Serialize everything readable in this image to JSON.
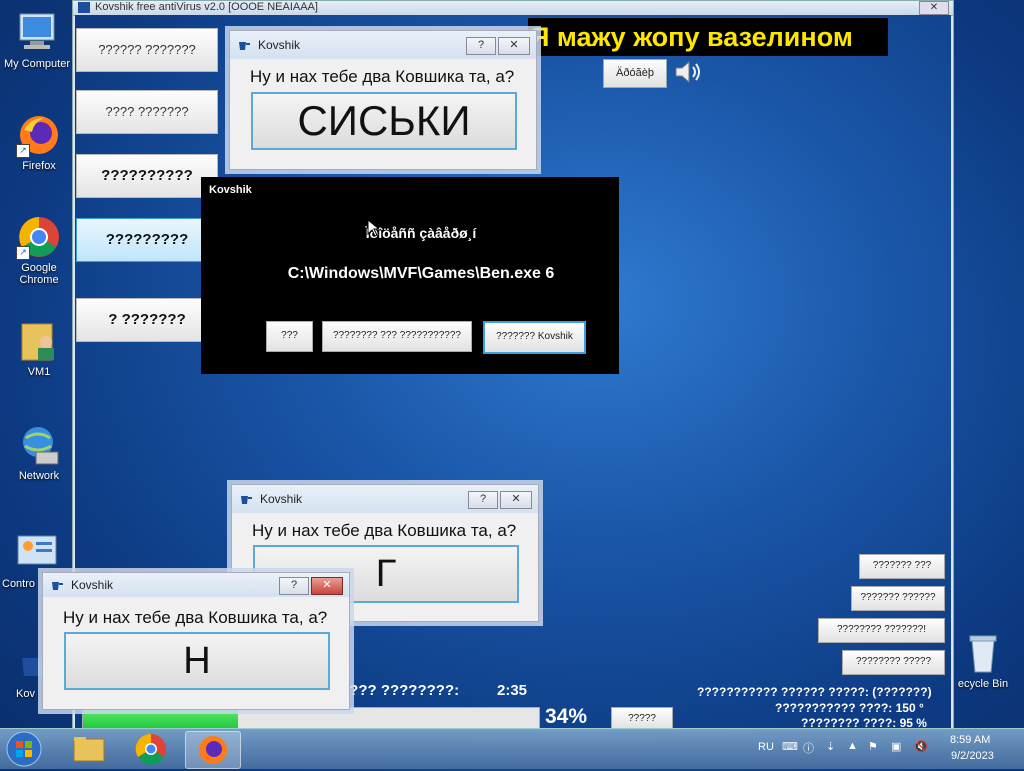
{
  "desktop": {
    "icons": [
      {
        "label": "My Computer"
      },
      {
        "label": "Firefox"
      },
      {
        "label": "Google Chrome"
      },
      {
        "label": "VM1"
      },
      {
        "label": "Network"
      },
      {
        "label": "Contro"
      },
      {
        "label": "Kov"
      },
      {
        "label": "ecycle Bin"
      }
    ]
  },
  "main_window": {
    "title": "Kovshik free antiVirus v2.0 [OOOE NEAIAAA]",
    "close_label": "✕",
    "side_buttons": [
      "?????? ???????",
      "???? ???????",
      "??????????",
      "?????????",
      "? ???????"
    ],
    "banner": "Я мажу жопу вазелином",
    "top_button": "Äðóãèþ",
    "right_buttons": [
      "??????? ???",
      "??????? ??????",
      "???????? ???????!",
      "???????? ?????"
    ],
    "elapsed_label": "???? ????????:",
    "elapsed_value": "2:35",
    "progress_percent_label": "34%",
    "progress_percent": 34,
    "bottom_button": "?????",
    "stats": [
      "??????????? ?????? ?????: (???????)",
      "??????????? ????:   150 °",
      "???????? ????:  95   %"
    ]
  },
  "dialog_top": {
    "title": "Kovshik",
    "help": "?",
    "close": "✕",
    "question": "Ну и нах тебе два Ковшика та, а?",
    "answer": "СИСЬКИ"
  },
  "dialog_mid": {
    "title": "Kovshik",
    "help": "?",
    "close": "✕",
    "question": "Ну и нах тебе два Ковшика та, а?",
    "answer": "Г"
  },
  "dialog_front": {
    "title": "Kovshik",
    "help": "?",
    "close": "✕",
    "question": "Ну и нах тебе два Ковшика та, а?",
    "answer": "Н"
  },
  "black_dialog": {
    "title": "Kovshik",
    "line1": "Ïðîöåññ çàâåðø¸í",
    "line2": "C:\\Windows\\MVF\\Games\\Ben.exe 6",
    "buttons": [
      "???",
      "???????? ??? ???????????",
      "??????? Kovshik"
    ]
  },
  "taskbar": {
    "language": "RU",
    "time": "8:59 AM",
    "date": "9/2/2023"
  },
  "colors": {
    "banner_text": "#ffe600",
    "progress": "#2ed94a",
    "desktop": "#1a56a8"
  }
}
